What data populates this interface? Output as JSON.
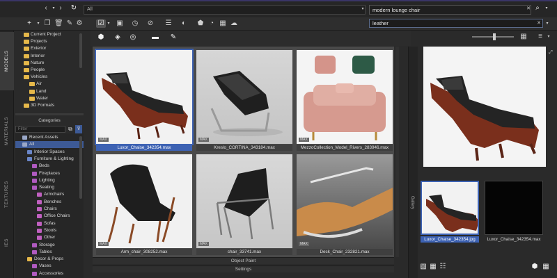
{
  "toolbar": {
    "path_value": "All",
    "search_value": "modern lounge chair",
    "filter_value": "leather"
  },
  "vtabs": [
    "MODELS",
    "MATERIALS",
    "TEXTURES",
    "IES"
  ],
  "library_tree": [
    {
      "label": "Current Project",
      "indent": 1
    },
    {
      "label": "Projects",
      "indent": 1
    },
    {
      "label": "Exterior",
      "indent": 1
    },
    {
      "label": "Interior",
      "indent": 1
    },
    {
      "label": "Nature",
      "indent": 1
    },
    {
      "label": "People",
      "indent": 1
    },
    {
      "label": "Vehicles",
      "indent": 1
    },
    {
      "label": "Air",
      "indent": 2
    },
    {
      "label": "Land",
      "indent": 2
    },
    {
      "label": "Water",
      "indent": 2
    },
    {
      "label": "3D Formats",
      "indent": 1
    }
  ],
  "categories_title": "Categories",
  "categories_filter_placeholder": "Filter",
  "categories": [
    {
      "label": "Recent Assets",
      "indent": 1
    },
    {
      "label": "All",
      "indent": 1,
      "selected": true
    },
    {
      "label": "Interior Spaces",
      "indent": 2
    },
    {
      "label": "Furniture & Lighting",
      "indent": 2
    },
    {
      "label": "Beds",
      "indent": 3
    },
    {
      "label": "Fireplaces",
      "indent": 3
    },
    {
      "label": "Lighting",
      "indent": 3
    },
    {
      "label": "Seating",
      "indent": 3
    },
    {
      "label": "Armchairs",
      "indent": 4
    },
    {
      "label": "Benches",
      "indent": 4
    },
    {
      "label": "Chairs",
      "indent": 4
    },
    {
      "label": "Office Chairs",
      "indent": 4
    },
    {
      "label": "Sofas",
      "indent": 4
    },
    {
      "label": "Stools",
      "indent": 4
    },
    {
      "label": "Other",
      "indent": 4
    },
    {
      "label": "Storage",
      "indent": 3
    },
    {
      "label": "Tables",
      "indent": 3
    },
    {
      "label": "Decor & Props",
      "indent": 2
    },
    {
      "label": "Vases",
      "indent": 3
    },
    {
      "label": "Accessories",
      "indent": 3
    }
  ],
  "assets": [
    {
      "name": "Luxor_Chaise_342354.max",
      "badge": "MAX",
      "selected": true
    },
    {
      "name": "Kreslo_CORTINA_343184.max",
      "badge": "MAX"
    },
    {
      "name": "MezzoCollection_Model_Rivers_283946.max",
      "badge": "MAX"
    },
    {
      "name": "Arm_chair_308252.max",
      "badge": "MAX"
    },
    {
      "name": "chair_33741.max",
      "badge": "MAX"
    },
    {
      "name": "Deck_Chair_232821.max",
      "badge": "MAX"
    }
  ],
  "panels": {
    "object_paint": "Object Paint",
    "settings": "Settings"
  },
  "gallery_label": "Gallery",
  "preview_files": [
    {
      "name": "Luxor_Chaise_342354.jpg",
      "selected": true
    },
    {
      "name": "Luxor_Chaise_342354.max"
    }
  ],
  "colors": {
    "accent": "#3d62b3",
    "selection": "#3d5a96",
    "folder": "#e6b84a"
  }
}
